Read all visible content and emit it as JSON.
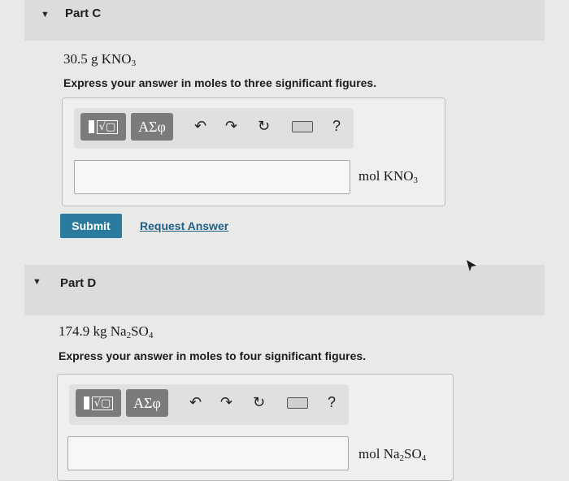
{
  "part_c": {
    "title": "Part C",
    "quantity": {
      "value": "30.5 g KNO",
      "subscript": "3"
    },
    "instruction": "Express your answer in moles to three significant figures.",
    "toolbar": {
      "greek_label": "ΑΣφ",
      "help_label": "?"
    },
    "unit": {
      "value": "mol KNO",
      "subscript": "3"
    },
    "submit_label": "Submit",
    "request_label": "Request Answer"
  },
  "part_d": {
    "title": "Part D",
    "quantity": {
      "value": "174.9 kg Na",
      "sub1": "2",
      "mid": "SO",
      "sub2": "4"
    },
    "instruction": "Express your answer in moles to four significant figures.",
    "toolbar": {
      "greek_label": "ΑΣφ",
      "help_label": "?"
    },
    "unit": {
      "value": "mol Na",
      "sub1": "2",
      "mid": "SO",
      "sub2": "4"
    }
  },
  "colors": {
    "accent": "#2a7b9e",
    "link": "#1f5e85"
  }
}
